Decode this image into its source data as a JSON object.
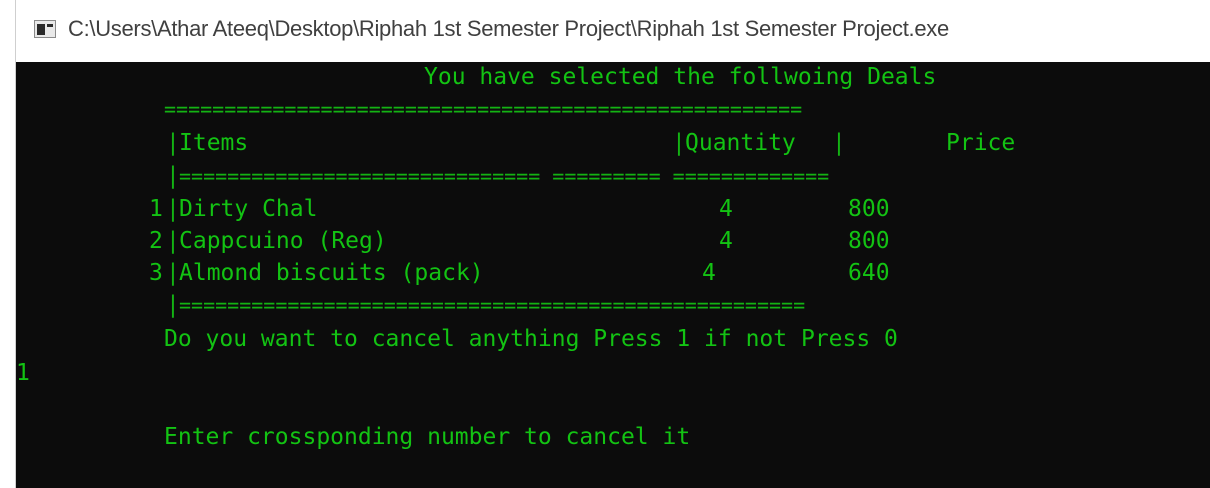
{
  "window": {
    "title": "C:\\Users\\Athar Ateeq\\Desktop\\Riphah 1st Semester Project\\Riphah 1st Semester Project.exe",
    "icon": "console-app-icon"
  },
  "console": {
    "heading": "You have selected the follwoing Deals",
    "rule_top": "=====================================================",
    "col_items": "Items",
    "col_quantity": "Quantity",
    "col_price": "Price",
    "rule_header": "============================== ========= =============",
    "rows": [
      {
        "num": "1",
        "item": "Dirty Chal",
        "qty": "4",
        "price": "800"
      },
      {
        "num": "2",
        "item": "Cappcuino (Reg)",
        "qty": "4",
        "price": "800"
      },
      {
        "num": "3",
        "item": "Almond biscuits (pack)",
        "qty": "4",
        "price": "640"
      }
    ],
    "rule_bottom": "====================================================",
    "prompt_cancel": "Do you want to cancel anything Press 1 if not Press 0",
    "user_input": "1",
    "prompt_number": "Enter crossponding number to cancel it",
    "text_color": "#13c313",
    "background_color": "#0c0c0c"
  }
}
